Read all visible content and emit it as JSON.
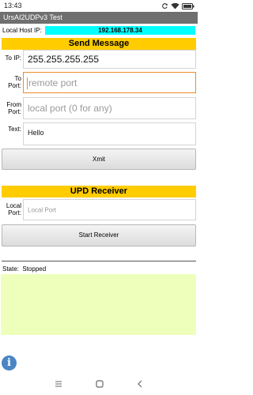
{
  "status_bar": {
    "time": "13:43",
    "icons": [
      "sync-icon",
      "wifi-icon",
      "battery-icon"
    ]
  },
  "app": {
    "title": "UrsAI2UDPv3 Test"
  },
  "local_host": {
    "label": "Local Host IP:",
    "value": "192.168.178.34"
  },
  "send_section": {
    "header": "Send Message",
    "to_ip": {
      "label": "To IP:",
      "value": "255.255.255.255"
    },
    "to_port": {
      "label_line1": "To",
      "label_line2": "Port:",
      "placeholder": "remote port"
    },
    "from_port": {
      "label_line1": "From",
      "label_line2": "Port:",
      "placeholder": "local port (0 for any)"
    },
    "text": {
      "label": "Text:",
      "value": "Hello"
    },
    "xmit_button": "Xmit"
  },
  "receiver_section": {
    "header": "UPD Receiver",
    "local_port": {
      "label_line1": "Local",
      "label_line2": "Port:",
      "placeholder": "Local Port"
    },
    "start_button": "Start Receiver"
  },
  "state": {
    "label": "State:",
    "value": "Stopped"
  },
  "colors": {
    "accent_yellow": "#ffcc00",
    "ip_cyan": "#00ffff",
    "log_green": "#eeffbb",
    "focus_orange": "#f08a2a",
    "info_blue": "#4a86c5"
  },
  "nav": {
    "icons": [
      "menu-icon",
      "home-icon",
      "back-icon"
    ]
  }
}
